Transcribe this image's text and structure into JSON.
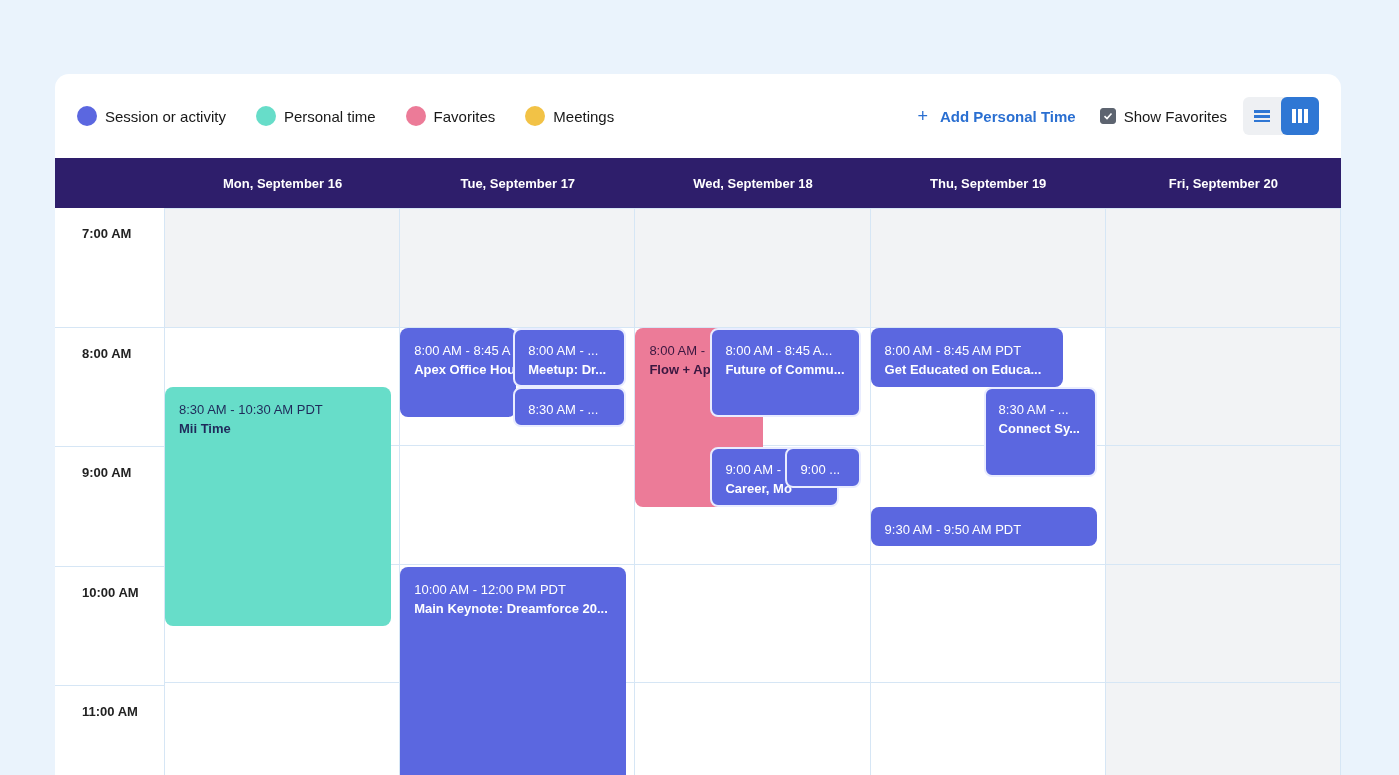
{
  "legend": [
    {
      "label": "Session or activity",
      "color": "#5b67e0",
      "kind": "session"
    },
    {
      "label": "Personal time",
      "color": "#67ddc9",
      "kind": "personal"
    },
    {
      "label": "Favorites",
      "color": "#ec7b98",
      "kind": "favorite"
    },
    {
      "label": "Meetings",
      "color": "#f2c246",
      "kind": "meeting"
    }
  ],
  "toolbar": {
    "add_button": {
      "icon": "+",
      "label": "Add Personal Time"
    },
    "show_favorites": {
      "label": "Show Favorites",
      "checked": true
    },
    "view_toggle": [
      {
        "kind": "list",
        "selected": false
      },
      {
        "kind": "columns",
        "selected": true
      }
    ]
  },
  "time_slots": [
    {
      "label": "7:00 AM",
      "shaded": true
    },
    {
      "label": "8:00 AM",
      "shaded": false
    },
    {
      "label": "9:00 AM",
      "shaded": false
    },
    {
      "label": "10:00 AM",
      "shaded": false
    },
    {
      "label": "11:00 AM",
      "shaded": false
    }
  ],
  "days": [
    {
      "label": "Mon, September 16",
      "shaded": false,
      "events": [
        {
          "kind": "personal",
          "time": "8:30 AM - 10:30 AM PDT",
          "title": "Mii Time"
        }
      ]
    },
    {
      "label": "Tue, September 17",
      "shaded": false,
      "events": [
        {
          "kind": "session",
          "time": "8:00 AM - 8:45 A",
          "title": "Apex Office Hou"
        },
        {
          "kind": "session",
          "time": "8:00 AM - ...",
          "title": "Meetup: Dr..."
        },
        {
          "kind": "session",
          "time": "8:30 AM - ..."
        },
        {
          "kind": "session",
          "time": "10:00 AM - 12:00 PM PDT",
          "title": "Main Keynote: Dreamforce 20..."
        }
      ]
    },
    {
      "label": "Wed, September 18",
      "shaded": false,
      "events": [
        {
          "kind": "favorite",
          "time": "8:00 AM -",
          "title": "Flow + Ap"
        },
        {
          "kind": "session",
          "time": "8:00 AM - 8:45 A...",
          "title": "Future of Commu..."
        },
        {
          "kind": "session",
          "time": "9:00 AM -",
          "title": "Career, Mo"
        },
        {
          "kind": "session",
          "time": "9:00 ..."
        }
      ]
    },
    {
      "label": "Thu, September 19",
      "shaded": false,
      "events": [
        {
          "kind": "session",
          "time": "8:00 AM - 8:45 AM PDT",
          "title": "Get Educated on Educa..."
        },
        {
          "kind": "session",
          "time": "8:30 AM - ...",
          "title": "Connect Sy..."
        },
        {
          "kind": "session",
          "time": "9:30 AM - 9:50 AM PDT"
        }
      ]
    },
    {
      "label": "Fri, September 20",
      "shaded": true
    }
  ]
}
